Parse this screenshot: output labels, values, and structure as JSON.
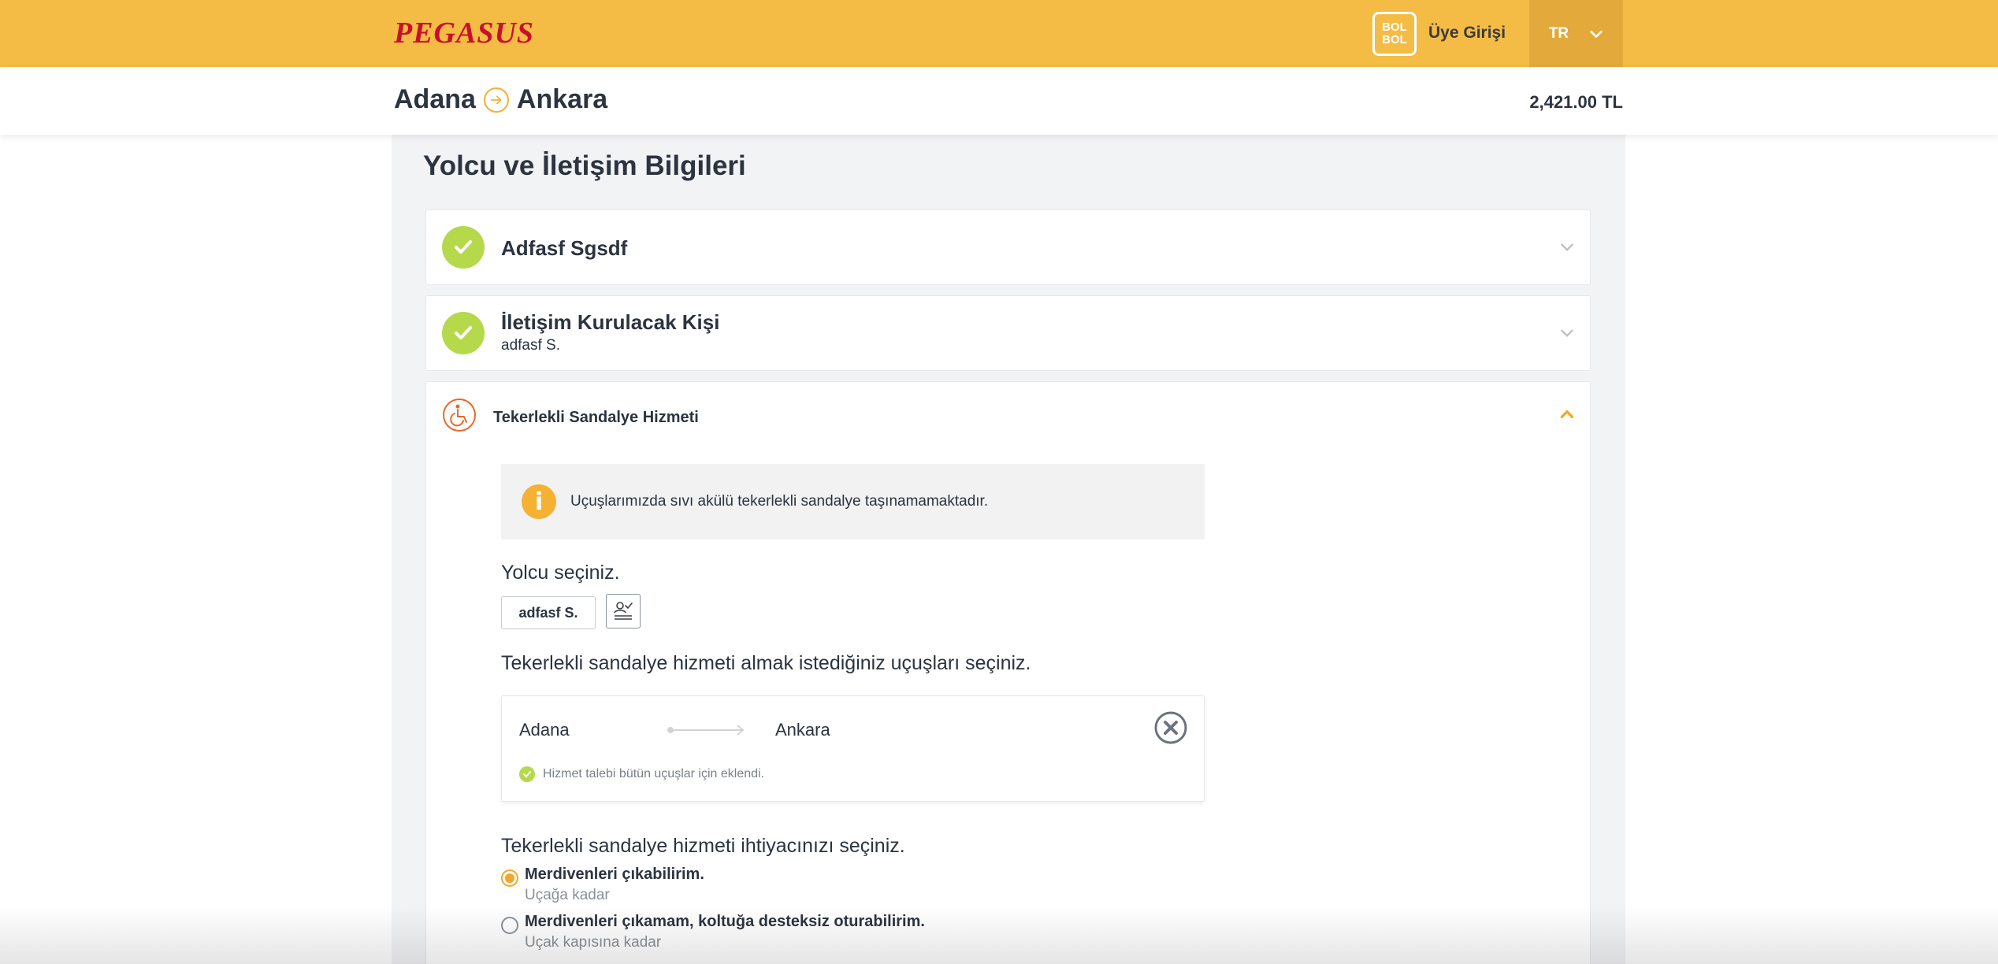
{
  "header": {
    "logo_text": "PEGASUS",
    "bolbol_line1": "BOL",
    "bolbol_line2": "BOL",
    "login_label": "Üye Girişi",
    "language": "TR"
  },
  "route": {
    "from": "Adana",
    "to": "Ankara",
    "price": "2,421.00 TL"
  },
  "main": {
    "title": "Yolcu ve İletişim Bilgileri",
    "passenger_card": {
      "name": "Adfasf Sgsdf"
    },
    "contact_card": {
      "title": "İletişim Kurulacak Kişi",
      "subtitle": "adfasf S."
    },
    "wheelchair": {
      "title": "Tekerlekli Sandalye Hizmeti",
      "notice": "Uçuşlarımızda sıvı akülü tekerlekli sandalye taşınamamaktadır.",
      "notice_icon": "i",
      "select_passenger_label": "Yolcu seçiniz.",
      "passenger_chip": "adfasf S.",
      "select_flights_label": "Tekerlekli sandalye hizmeti almak istediğiniz uçuşları seçiniz.",
      "flight": {
        "from": "Adana",
        "to": "Ankara",
        "status": "Hizmet talebi bütün uçuşlar için eklendi."
      },
      "need_label": "Tekerlekli sandalye hizmeti ihtiyacınızı seçiniz.",
      "options": [
        {
          "label": "Merdivenleri çıkabilirim.",
          "sub": "Uçağa kadar",
          "selected": true
        },
        {
          "label": "Merdivenleri çıkamam, koltuğa desteksiz oturabilirim.",
          "sub": "Uçak kapısına kadar",
          "selected": false
        }
      ]
    }
  },
  "colors": {
    "brand_yellow": "#f4bc44",
    "brand_red": "#c8102e",
    "success_green": "#b6d94c",
    "accent_orange": "#f4a62a"
  }
}
